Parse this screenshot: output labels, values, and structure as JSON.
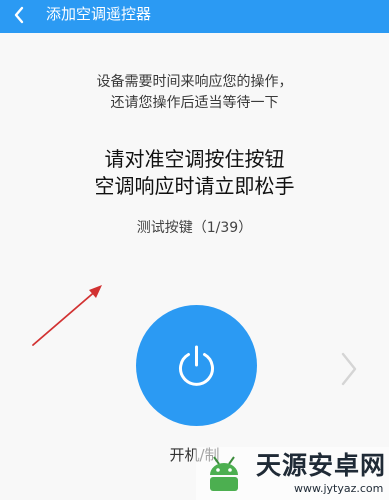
{
  "header": {
    "back_icon": "chevron-left-icon",
    "title": "添加空调遥控器"
  },
  "notice": {
    "line1": "设备需要时间来响应您的操作，",
    "line2": "还请您操作后适当等待一下"
  },
  "instruction": {
    "line1": "请对准空调按住按钮",
    "line2": "空调响应时请立即松手"
  },
  "progress_text": "测试按键（1/39）",
  "power_button": {
    "icon": "power-icon"
  },
  "next_icon": "chevron-right-icon",
  "key_label": "开机/制",
  "watermark": {
    "title": "天源安卓网",
    "url": "www.jytyaz.com"
  },
  "colors": {
    "accent": "#2b9af3",
    "background": "#f8f8f8",
    "annotation_arrow": "#d23232"
  }
}
